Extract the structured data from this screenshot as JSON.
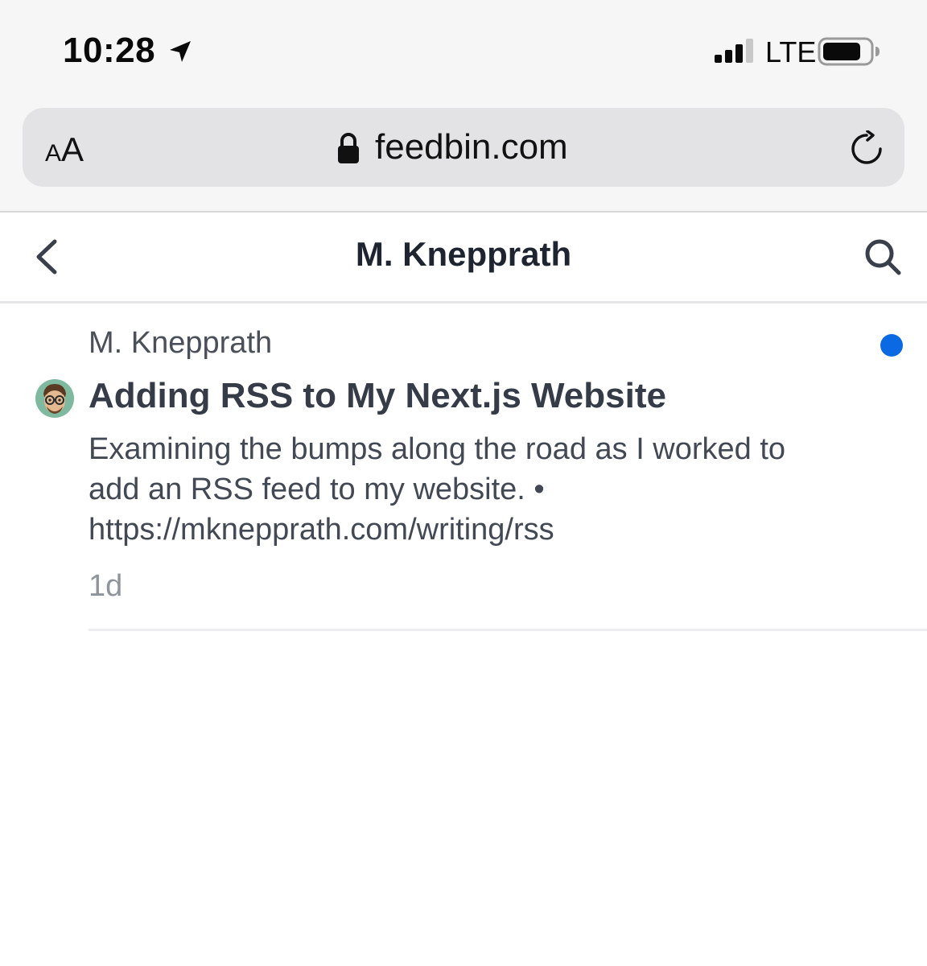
{
  "status_bar": {
    "time": "10:28",
    "network": "LTE",
    "icons": [
      "location-arrow-icon",
      "cellular-signal-icon",
      "battery-icon"
    ]
  },
  "browser": {
    "text_size_small": "A",
    "text_size_large": "A",
    "url": "feedbin.com",
    "icons": [
      "lock-icon",
      "reload-icon"
    ]
  },
  "header": {
    "title": "M. Knepprath",
    "icons": [
      "back-chevron-icon",
      "search-icon"
    ]
  },
  "entry": {
    "feed_name": "M. Knepprath",
    "title": "Adding RSS to My Next.js Website",
    "summary_lines": [
      "Examining the bumps along the road as I worked to",
      "add an RSS feed to my website. •",
      "https://mknepprath.com/writing/rss"
    ],
    "age": "1d",
    "unread": true,
    "unread_color": "#0b69e3"
  },
  "colors": {
    "title_text": "#1f2530",
    "accent": "#0b69e3"
  }
}
